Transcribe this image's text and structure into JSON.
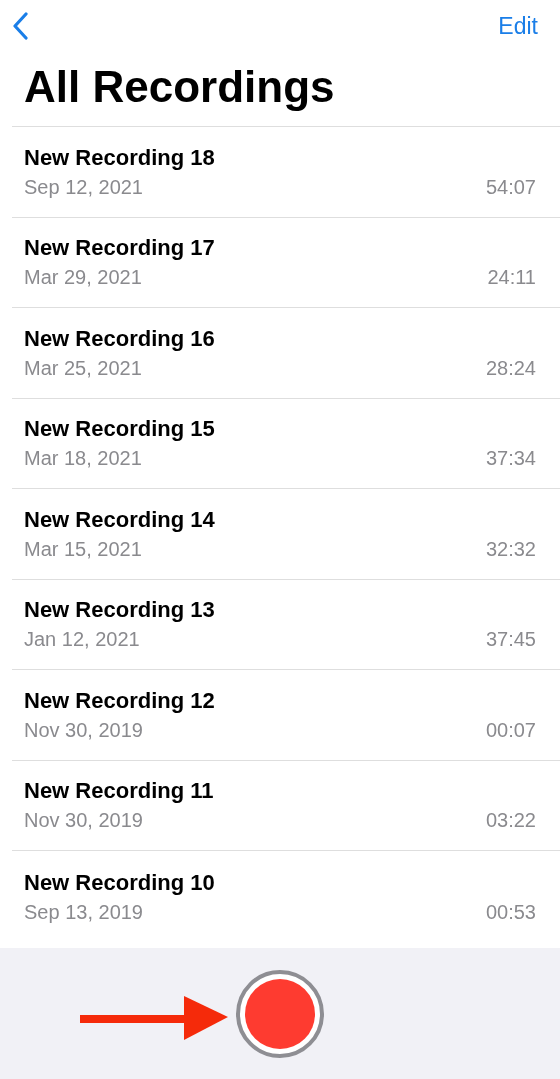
{
  "nav": {
    "edit": "Edit"
  },
  "title": "All Recordings",
  "recordings": [
    {
      "name": "New Recording 18",
      "date": "Sep 12, 2021",
      "duration": "54:07"
    },
    {
      "name": "New Recording 17",
      "date": "Mar 29, 2021",
      "duration": "24:11"
    },
    {
      "name": "New Recording 16",
      "date": "Mar 25, 2021",
      "duration": "28:24"
    },
    {
      "name": "New Recording 15",
      "date": "Mar 18, 2021",
      "duration": "37:34"
    },
    {
      "name": "New Recording 14",
      "date": "Mar 15, 2021",
      "duration": "32:32"
    },
    {
      "name": "New Recording 13",
      "date": "Jan 12, 2021",
      "duration": "37:45"
    },
    {
      "name": "New Recording 12",
      "date": "Nov 30, 2019",
      "duration": "00:07"
    },
    {
      "name": "New Recording 11",
      "date": "Nov 30, 2019",
      "duration": "03:22"
    },
    {
      "name": "New Recording 10",
      "date": "Sep 13, 2019",
      "duration": "00:53"
    }
  ]
}
